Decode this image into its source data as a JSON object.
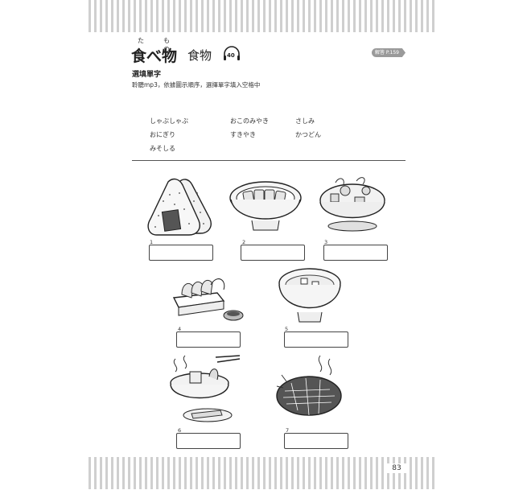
{
  "title": {
    "japanese": "食べ物",
    "ruby_ta": "た",
    "ruby_mono": "もの",
    "chinese": "食物",
    "track": "40"
  },
  "answer_tag": "解答 P.159",
  "section": {
    "title": "選填單字",
    "instruction": "聆聽mp3，依據圖示順序，選擇單字填入空格中"
  },
  "word_bank": [
    "しゃぶしゃぶ",
    "おにぎり",
    "みそしる",
    "おこのみやき",
    "すきやき",
    "さしみ",
    "かつどん"
  ],
  "questions": [
    "1",
    "2",
    "3",
    "4",
    "5",
    "6",
    "7"
  ],
  "food_icons": [
    "onigiri-icon",
    "katsudon-icon",
    "sukiyaki-icon",
    "sashimi-icon",
    "miso-soup-icon",
    "shabu-shabu-icon",
    "okonomiyaki-icon"
  ],
  "page_number": "83"
}
